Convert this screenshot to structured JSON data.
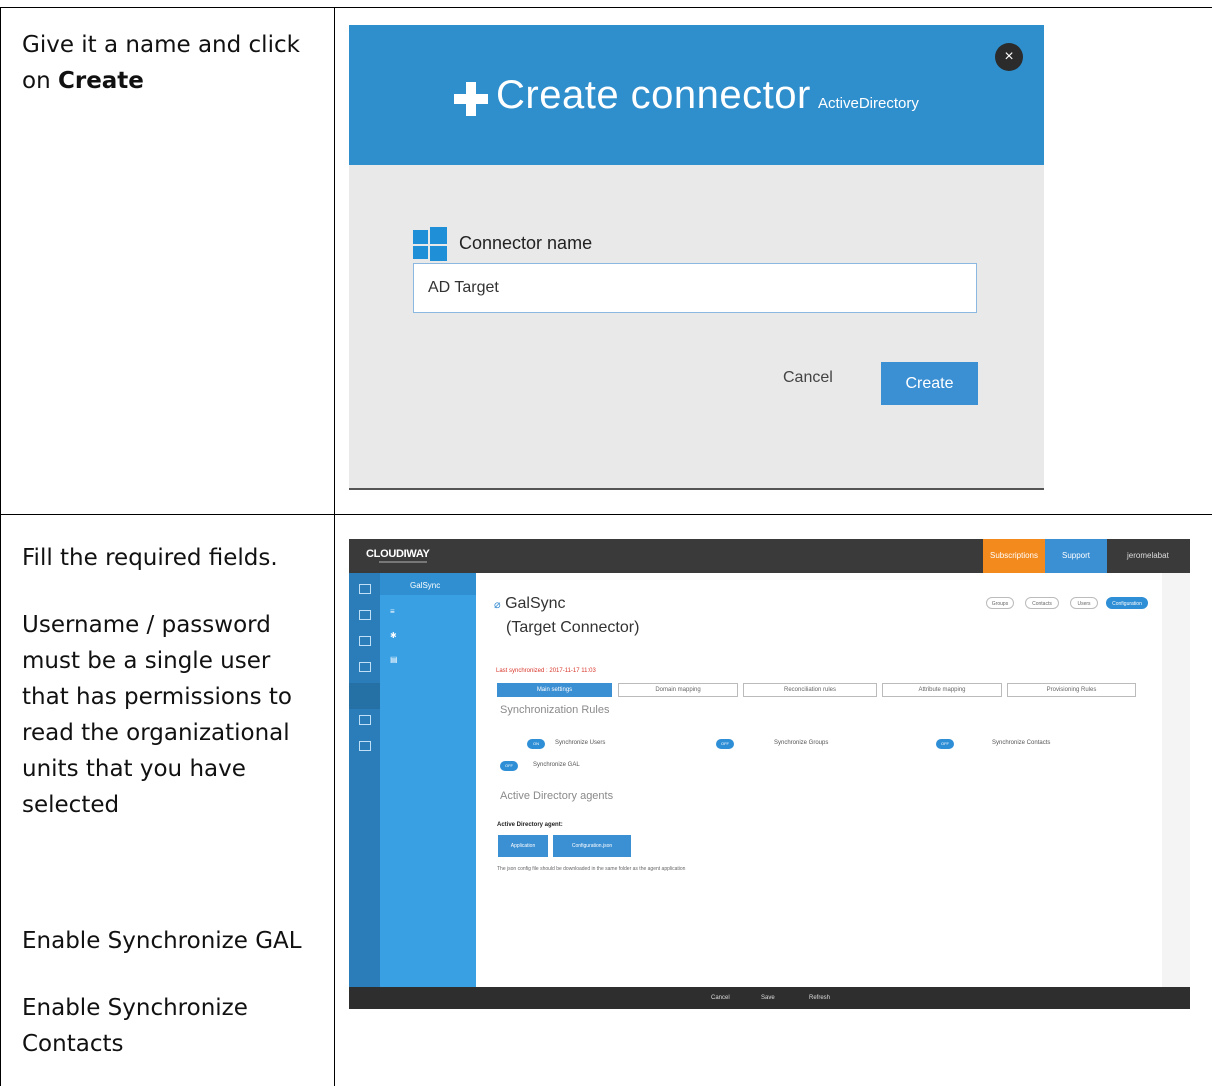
{
  "row1": {
    "instruction_plain": "Give it a name and click on ",
    "instruction_bold": "Create"
  },
  "row2": {
    "line1": "Fill the required fields.",
    "line2": "Username / password must be a single user that has permissions to read the organizational units that you have selected",
    "line3": "Enable Synchronize GAL",
    "line4": "Enable Synchronize Contacts"
  },
  "dialog": {
    "title": "Create connector",
    "subtitle": "ActiveDirectory",
    "close_glyph": "×",
    "field_label": "Connector name",
    "field_value": "AD Target",
    "cancel_label": "Cancel",
    "create_label": "Create",
    "header_color": "#2f8fcd",
    "button_color": "#3b8fd3"
  },
  "app": {
    "logo": "CLOUDIWAY",
    "topbar": {
      "subscriptions": "Subscriptions",
      "support": "Support",
      "user": "jeromelabat"
    },
    "nav": {
      "items": [
        "GalSync"
      ]
    },
    "pills": [
      "Groups",
      "Contacts",
      "Users",
      "Configuration"
    ],
    "title": "GalSync",
    "subtitle": "(Target Connector)",
    "last_sync": "Last synchronized : 2017-11-17 11:03",
    "tabs": [
      "Main settings",
      "Domain mapping",
      "Reconciliation rules",
      "Attribute mapping",
      "Provisioning Rules"
    ],
    "sync_rules_heading": "Synchronization Rules",
    "toggles": [
      {
        "state": "ON",
        "label": "Synchronize Users"
      },
      {
        "state": "OFF",
        "label": "Synchronize Groups"
      },
      {
        "state": "OFF",
        "label": "Synchronize Contacts"
      },
      {
        "state": "OFF",
        "label": "Synchronize GAL"
      }
    ],
    "agents_heading": "Active Directory agents",
    "agent_label": "Active Directory agent:",
    "agent_buttons": [
      "Application",
      "Configuration.json"
    ],
    "note": "The json config file should be downloaded in the same folder as the agent application",
    "bottom": [
      "Cancel",
      "Save",
      "Refresh"
    ],
    "accent_orange": "#f28a1e",
    "accent_blue": "#3b8fd3"
  }
}
